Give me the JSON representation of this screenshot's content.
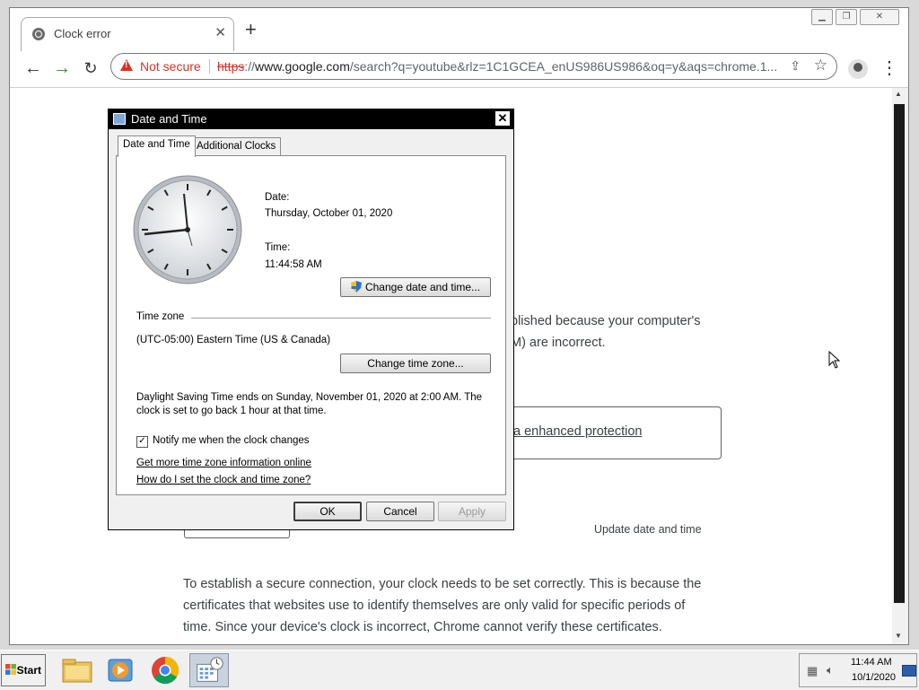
{
  "browser": {
    "tab_title": "Clock error",
    "new_tab": "+",
    "url_warning": "Not secure",
    "url_scheme": "https",
    "url_rest": "://",
    "url_host": "www.google.com",
    "url_path": "/search?q=youtube&rlz=1C1GCEA_enUS986US986&oq=y&aqs=chrome.1..."
  },
  "page": {
    "line1": "blished because your computer's",
    "line2": "M) are incorrect.",
    "enhanced_link": "a enhanced protection",
    "update_link": "Update date and time",
    "para1": "To establish a secure connection, your clock needs to be set correctly. This is because the",
    "para2": "certificates that websites use to identify themselves are only valid for specific periods of",
    "para3": "time. Since your device's clock is incorrect, Chrome cannot verify these certificates."
  },
  "dialog": {
    "title": "Date and Time",
    "tabs": [
      "Date and Time",
      "Additional Clocks"
    ],
    "date_label": "Date:",
    "date_value": "Thursday, October 01, 2020",
    "time_label": "Time:",
    "time_value": "11:44:58 AM",
    "change_datetime_btn": "Change date and time...",
    "timezone_heading": "Time zone",
    "timezone_value": "(UTC-05:00) Eastern Time (US & Canada)",
    "change_timezone_btn": "Change time zone...",
    "dst_line1": "Daylight Saving Time ends on Sunday, November 01, 2020 at 2:00 AM. The",
    "dst_line2": "clock is set to go back 1 hour at that time.",
    "notify_label": "Notify me when the clock changes",
    "notify_checked": true,
    "link1": "Get more time zone information online",
    "link2": "How do I set the clock and time zone?",
    "ok_btn": "OK",
    "cancel_btn": "Cancel",
    "apply_btn": "Apply"
  },
  "taskbar": {
    "start_label": "Start",
    "clock_time": "11:44 AM",
    "clock_date": "10/1/2020"
  }
}
